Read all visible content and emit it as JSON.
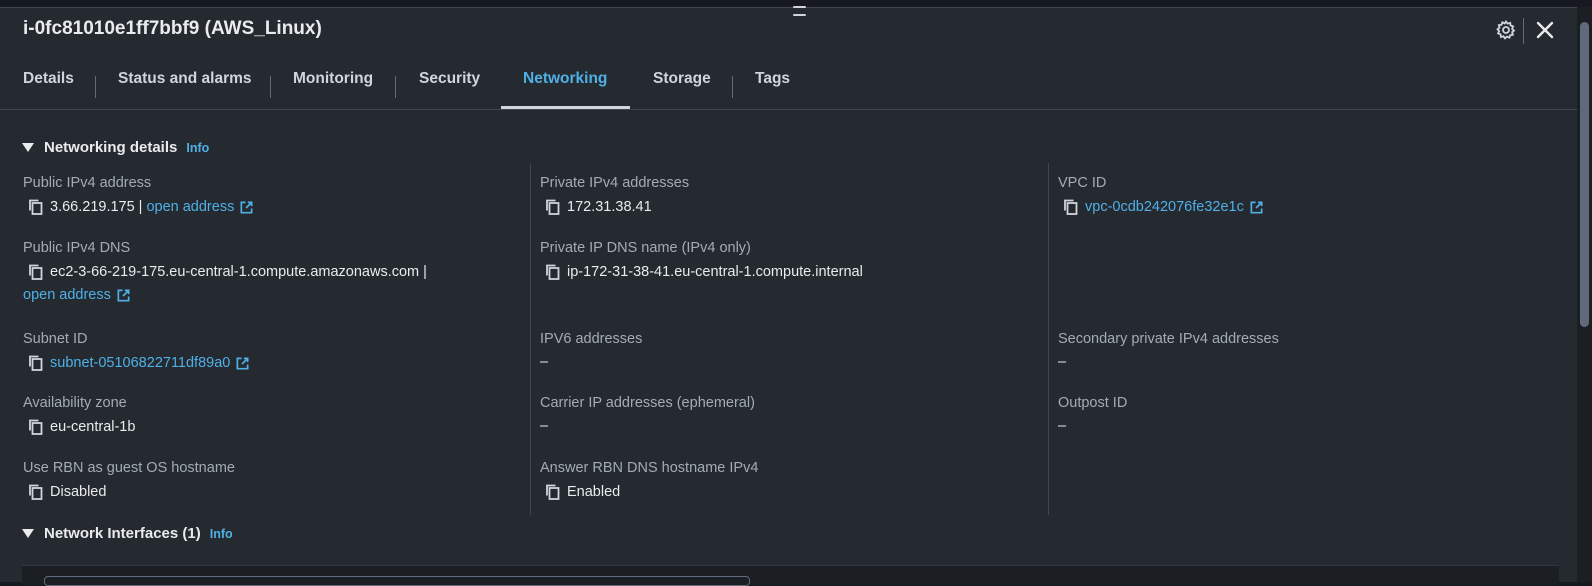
{
  "header": {
    "title": "i-0fc81010e1ff7bbf9 (AWS_Linux)",
    "settings_icon": "gear-icon",
    "close_icon": "close-icon"
  },
  "tabs": [
    {
      "label": "Details"
    },
    {
      "label": "Status and alarms"
    },
    {
      "label": "Monitoring"
    },
    {
      "label": "Security"
    },
    {
      "label": "Networking",
      "active": true
    },
    {
      "label": "Storage"
    },
    {
      "label": "Tags"
    }
  ],
  "networking_details": {
    "heading": "Networking details",
    "info": "Info",
    "public_ipv4": {
      "label": "Public IPv4 address",
      "value": "3.66.219.175",
      "separator": "|",
      "link": "open address"
    },
    "public_dns": {
      "label": "Public IPv4 DNS",
      "value": "ec2-3-66-219-175.eu-central-1.compute.amazonaws.com",
      "separator": "|",
      "link": "open address"
    },
    "subnet": {
      "label": "Subnet ID",
      "value": "subnet-05106822711df89a0"
    },
    "az": {
      "label": "Availability zone",
      "value": "eu-central-1b"
    },
    "rbn_hostname": {
      "label": "Use RBN as guest OS hostname",
      "value": "Disabled"
    },
    "private_ipv4": {
      "label": "Private IPv4 addresses",
      "value": "172.31.38.41"
    },
    "private_dns": {
      "label": "Private IP DNS name (IPv4 only)",
      "value": "ip-172-31-38-41.eu-central-1.compute.internal"
    },
    "ipv6": {
      "label": "IPV6 addresses",
      "value": "–"
    },
    "carrier_ip": {
      "label": "Carrier IP addresses (ephemeral)",
      "value": "–"
    },
    "answer_rbn": {
      "label": "Answer RBN DNS hostname IPv4",
      "value": "Enabled"
    },
    "vpc": {
      "label": "VPC ID",
      "value": "vpc-0cdb242076fe32e1c"
    },
    "secondary_ipv4": {
      "label": "Secondary private IPv4 addresses",
      "value": "–"
    },
    "outpost": {
      "label": "Outpost ID",
      "value": "–"
    }
  },
  "network_interfaces": {
    "heading": "Network Interfaces (1)",
    "info": "Info"
  },
  "colors": {
    "accent": "#4fb0e6",
    "background": "#252a31"
  }
}
